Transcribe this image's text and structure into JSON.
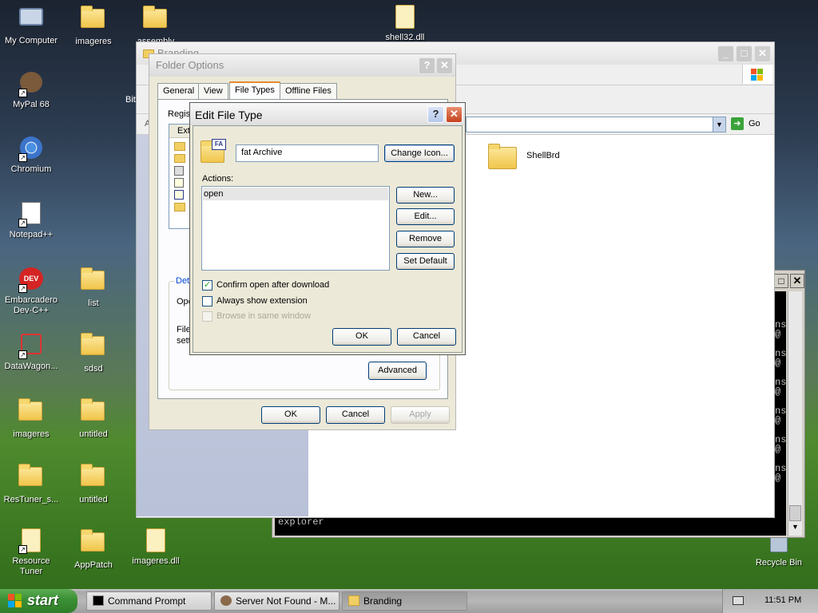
{
  "desktop_icons": [
    {
      "label": "My Computer"
    },
    {
      "label": "imageres"
    },
    {
      "label": "assembly"
    },
    {
      "label": "shell32.dll"
    },
    {
      "label": "MyPal 68"
    },
    {
      "label": "Chromium"
    },
    {
      "label": "Notepad++"
    },
    {
      "label": "Embarcadero Dev-C++"
    },
    {
      "label": "list"
    },
    {
      "label": "DataWagon..."
    },
    {
      "label": "sdsd"
    },
    {
      "label": "imageres"
    },
    {
      "label": "untitled"
    },
    {
      "label": "ResTuner_s..."
    },
    {
      "label": "untitled"
    },
    {
      "label": "Resource Tuner"
    },
    {
      "label": "AppPatch"
    },
    {
      "label": "imageres.dll"
    },
    {
      "label": "Recycle Bin"
    }
  ],
  "explorer": {
    "title": "Branding",
    "go_label": "Go",
    "folder_item": "ShellBrd",
    "partial_left_label": "Bit"
  },
  "console": {
    "text": "explorer",
    "fragments": [
      "ns",
      "@",
      "ns",
      "@",
      "ns",
      "@",
      "ns",
      "@",
      "ns",
      "@",
      "ns",
      "@"
    ]
  },
  "folder_options": {
    "title": "Folder Options",
    "tabs": [
      "General",
      "View",
      "File Types",
      "Offline Files"
    ],
    "registered_label": "Regis",
    "ext_header": "Exte",
    "details_label": "Deta",
    "opens_label": "Ope",
    "files_label": "Files",
    "setting_label": "setti",
    "advanced_label": "Advanced",
    "ok_label": "OK",
    "cancel_label": "Cancel",
    "apply_label": "Apply"
  },
  "edit_file_type": {
    "title": "Edit File Type",
    "type_name": "fat Archive",
    "change_icon_label": "Change Icon...",
    "actions_label": "Actions:",
    "actions": [
      "open"
    ],
    "new_label": "New...",
    "edit_label": "Edit...",
    "remove_label": "Remove",
    "set_default_label": "Set Default",
    "confirm_open_label": "Confirm open after download",
    "confirm_open_checked": true,
    "always_show_ext_label": "Always show extension",
    "always_show_ext_checked": false,
    "browse_same_label": "Browse in same window",
    "browse_same_enabled": false,
    "ok_label": "OK",
    "cancel_label": "Cancel",
    "icon_badge": "FA"
  },
  "taskbar": {
    "start_label": "start",
    "tasks": [
      {
        "label": "Command Prompt"
      },
      {
        "label": "Server Not Found - M..."
      },
      {
        "label": "Branding"
      }
    ],
    "clock": "11:51 PM"
  },
  "colors": {
    "xp_accent": "#0a246a",
    "close_red": "#c4411c",
    "start_green": "#3c9135"
  }
}
